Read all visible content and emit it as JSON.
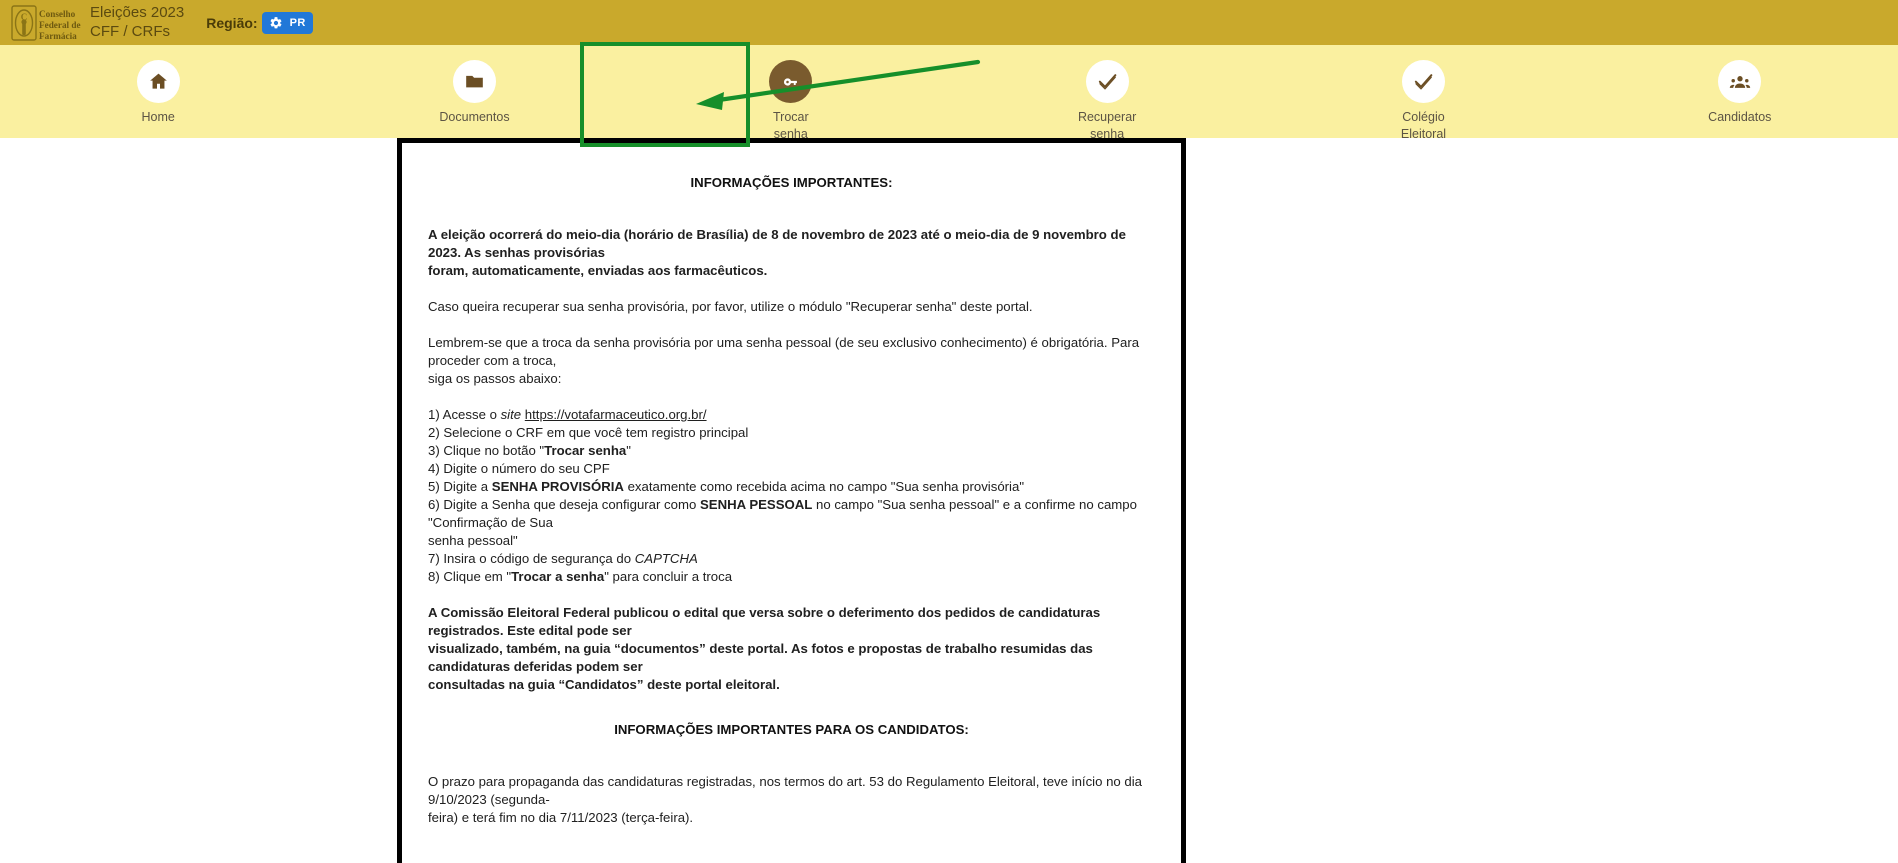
{
  "header": {
    "logo_alt": "Conselho Federal de Farmácia",
    "brand_line_1": "Eleições 2023",
    "brand_line_2": "CFF / CRFs",
    "regiao_label": "Região:",
    "regiao_badge_uf": "PR",
    "bar_color": "#c9a92c",
    "badge_color": "#2178d8"
  },
  "nav": {
    "strip_color": "#faf0a0",
    "active_icon_bg": "#7a5b2e",
    "items": [
      {
        "label": "Home",
        "icon": "home-icon",
        "active": false
      },
      {
        "label": "Documentos",
        "icon": "folder-icon",
        "active": false
      },
      {
        "label": "Trocar\nsenha",
        "icon": "key-icon",
        "active": true
      },
      {
        "label": "Recuperar\nsenha",
        "icon": "check-icon",
        "active": false
      },
      {
        "label": "Colégio\nEleitoral",
        "icon": "check-icon",
        "active": false
      },
      {
        "label": "Candidatos",
        "icon": "people-icon",
        "active": false
      }
    ]
  },
  "annotation": {
    "highlight_color": "#168f2a",
    "target": "Trocar senha"
  },
  "document": {
    "title": "INFORMAÇÕES IMPORTANTES:",
    "p_election_1": "A eleição ocorrerá do meio-dia (horário de Brasília) de 8 de novembro de 2023 até o meio-dia de 9 novembro de 2023. As senhas provisórias",
    "p_election_2": "foram, automaticamente, enviadas aos farmacêuticos.",
    "p_recover": "Caso queira recuperar sua senha provisória, por favor, utilize o módulo \"Recuperar senha\" deste portal.",
    "p_remember_1": "Lembrem-se que a troca da senha provisória por uma senha pessoal (de seu exclusivo conhecimento) é obrigatória. Para proceder com a troca,",
    "p_remember_2": "siga os passos abaixo:",
    "steps": {
      "s1_a": "1) Acesse o ",
      "s1_site": "site",
      "s1_url": "https://votafarmaceutico.org.br/",
      "s2": "2) Selecione o CRF em que você tem registro principal",
      "s3_a": "3) Clique no botão \"",
      "s3_b": "Trocar senha",
      "s3_c": "\"",
      "s4": "4) Digite o número do seu CPF",
      "s5_a": "5) Digite a ",
      "s5_b": "SENHA PROVISÓRIA",
      "s5_c": " exatamente como recebida acima no campo \"Sua senha provisória\"",
      "s6_a": "6) Digite a Senha que deseja configurar como ",
      "s6_b": "SENHA PESSOAL",
      "s6_c": " no campo \"Sua senha pessoal\" e a confirme no campo \"Confirmação de Sua",
      "s6_d": "senha pessoal\"",
      "s7_a": "7) Insira o código de segurança do ",
      "s7_b": "CAPTCHA",
      "s8_a": "8) Clique em \"",
      "s8_b": "Trocar a senha",
      "s8_c": "\" para concluir a troca"
    },
    "p_edital_1": "A Comissão Eleitoral Federal publicou o edital que versa sobre o deferimento dos pedidos de candidaturas registrados. Este edital pode ser",
    "p_edital_2": "visualizado, também, na guia “documentos” deste portal. As fotos e propostas de trabalho resumidas das candidaturas deferidas podem ser",
    "p_edital_3": "consultadas na guia “Candidatos” deste portal eleitoral.",
    "subtitle_candidatos": "INFORMAÇÕES IMPORTANTES PARA OS CANDIDATOS:",
    "p_prazo_1": "O prazo para propaganda das candidaturas registradas, nos termos do art. 53 do Regulamento Eleitoral, teve início no dia 9/10/2023 (segunda-",
    "p_prazo_2": "feira) e terá fim no dia 7/11/2023 (terça-feira)."
  }
}
